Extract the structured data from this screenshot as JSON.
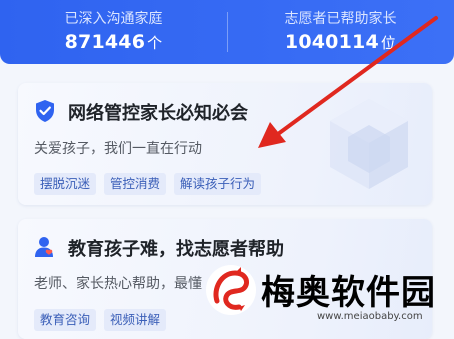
{
  "stats": {
    "left": {
      "label": "已深入沟通家庭",
      "value": "871446",
      "unit": "个"
    },
    "right": {
      "label": "志愿者已帮助家长",
      "value": "1040114",
      "unit": "位"
    }
  },
  "cards": [
    {
      "title": "网络管控家长必知必会",
      "subtitle": "关爱孩子，我们一直在行动",
      "tags": [
        "摆脱沉迷",
        "管控消费",
        "解读孩子行为"
      ],
      "icon": "shield-check-icon"
    },
    {
      "title": "教育孩子难，找志愿者帮助",
      "subtitle": "老师、家长热心帮助，最懂",
      "tags": [
        "教育咨询",
        "视频讲解"
      ],
      "icon": "volunteer-person-icon"
    }
  ],
  "watermark": {
    "name": "梅奥软件园",
    "url": "www.meiaobaby.com"
  },
  "colors": {
    "banner": "#3568f3",
    "accent": "#2f63f0",
    "arrow": "#e0281f",
    "tag_bg": "#e4eafa",
    "tag_text": "#3b5fb8"
  }
}
